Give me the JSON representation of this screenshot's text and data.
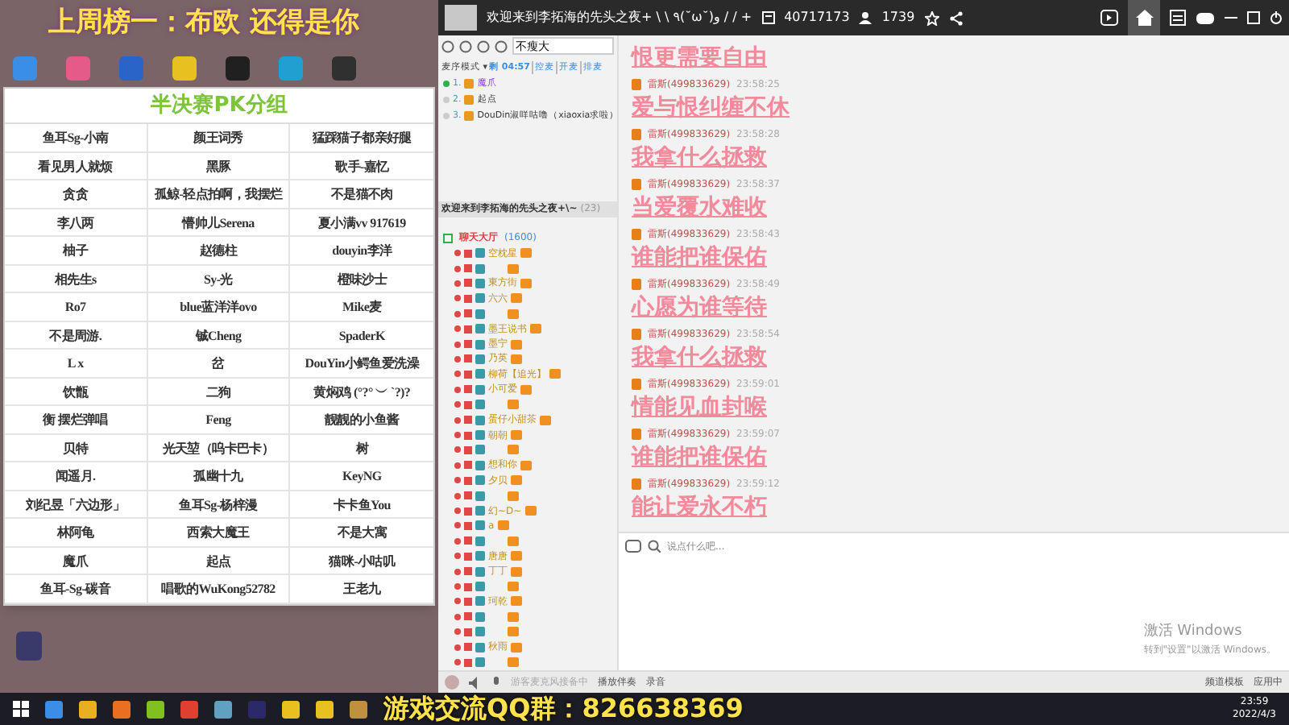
{
  "overlay_top": "上周榜一：布欧 还得是你",
  "pk_table": {
    "title": "半决赛PK分组",
    "rows": [
      [
        "鱼耳Sg-小南",
        "颜王词秀",
        "猛踩猫子都亲好腿"
      ],
      [
        "看见男人就烦",
        "黑豚",
        "歌手-嘉忆"
      ],
      [
        "贪贪",
        "孤鲸-轻点拍啊，我摆烂",
        "不是猫不肉"
      ],
      [
        "李八两",
        "懵帅儿Serena",
        "夏小满vv 917619"
      ],
      [
        "柚子",
        "赵德柱",
        "douyin李洋"
      ],
      [
        "相先生s",
        "Sy-光",
        "橙味沙士"
      ],
      [
        "Ro7",
        "blue蓝洋洋ovo",
        "Mike麦"
      ],
      [
        "不是周游.",
        "铖Cheng",
        "SpaderK"
      ],
      [
        "L x",
        "岔",
        "DouYin小鳄鱼爱洗澡"
      ],
      [
        "饮甑",
        "二狗",
        "黄焖鸡 (°?° ︶ `?)?"
      ],
      [
        "衡 摆烂弹唱",
        "Feng",
        "靓靓的小鱼酱"
      ],
      [
        "贝特",
        "光天堃（呜卡巴卡）",
        "树"
      ],
      [
        "闻遥月.",
        "孤幽十九",
        "KeyNG"
      ],
      [
        "刘纪昱「六边形」",
        "鱼耳Sg-杨梓漫",
        "卡卡鱼You"
      ],
      [
        "林阿龟",
        "西索大魔王",
        "不是大寓"
      ],
      [
        "魔爪",
        "起点",
        "猫咪-小咕叽"
      ],
      [
        "鱼耳-Sg-碳音",
        "唱歌的WuKong52782",
        "王老九"
      ]
    ]
  },
  "window": {
    "title": "欢迎来到李拓海的先头之夜+ \\ \\ ٩(˘ω˘)و / / +",
    "room_id": "40717173",
    "online": "1739"
  },
  "left_panel": {
    "search": {
      "value": "不瘦大"
    },
    "mode": "麦序模式 ▾",
    "timer": "剩 04:57",
    "actions": [
      "控麦",
      "开麦",
      "排麦"
    ],
    "queue": [
      {
        "rank": "1.",
        "name": "魔爪",
        "active": true
      },
      {
        "rank": "2.",
        "name": "起点",
        "active": false
      },
      {
        "rank": "3.",
        "name": "DouDin淑咩咕噜（xiaoxia求啦）",
        "active": false
      }
    ],
    "channel": {
      "name": "欢迎来到李拓海的先头之夜+\\~",
      "count": "(23)",
      "sub": "聊天大厅",
      "sub_count": "(1600)"
    },
    "users": [
      {
        "kind": "named",
        "name": "空枕星"
      },
      {
        "kind": "anonymous"
      },
      {
        "kind": "named",
        "name": "東方街"
      },
      {
        "kind": "named",
        "name": "六六"
      },
      {
        "kind": "anonymous"
      },
      {
        "kind": "named",
        "name": "墨王说书"
      },
      {
        "kind": "named",
        "name": "墨宁"
      },
      {
        "kind": "named",
        "name": "乃英"
      },
      {
        "kind": "named",
        "name": "柳荷【追光】"
      },
      {
        "kind": "named",
        "name": "小可爱"
      },
      {
        "kind": "anonymous"
      },
      {
        "kind": "named",
        "name": "蛋仔小甜茶"
      },
      {
        "kind": "named",
        "name": "朝朝"
      },
      {
        "kind": "anonymous"
      },
      {
        "kind": "named",
        "name": "想和你"
      },
      {
        "kind": "named",
        "name": "夕贝"
      },
      {
        "kind": "anonymous"
      },
      {
        "kind": "named",
        "name": "幻~D~"
      },
      {
        "kind": "named",
        "name": "a"
      },
      {
        "kind": "anonymous"
      },
      {
        "kind": "named",
        "name": "唐唐"
      },
      {
        "kind": "named",
        "name": "丁丁"
      },
      {
        "kind": "anonymous"
      },
      {
        "kind": "named",
        "name": "珂乾"
      },
      {
        "kind": "anonymous"
      },
      {
        "kind": "anonymous"
      },
      {
        "kind": "named",
        "name": "秋雨"
      },
      {
        "kind": "anonymous"
      }
    ]
  },
  "chat": {
    "first_message": "恨更需要自由",
    "messages": [
      {
        "sender": "雷斯(499833629)",
        "time": "23:58:25",
        "text": "爱与恨纠缠不休"
      },
      {
        "sender": "雷斯(499833629)",
        "time": "23:58:28",
        "text": "我拿什么拯救"
      },
      {
        "sender": "雷斯(499833629)",
        "time": "23:58:37",
        "text": "当爱覆水难收"
      },
      {
        "sender": "雷斯(499833629)",
        "time": "23:58:43",
        "text": "谁能把谁保佑"
      },
      {
        "sender": "雷斯(499833629)",
        "time": "23:58:49",
        "text": "心愿为谁等待"
      },
      {
        "sender": "雷斯(499833629)",
        "time": "23:58:54",
        "text": "我拿什么拯救"
      },
      {
        "sender": "雷斯(499833629)",
        "time": "23:59:01",
        "text": "情能见血封喉"
      },
      {
        "sender": "雷斯(499833629)",
        "time": "23:59:07",
        "text": "谁能把谁保佑"
      },
      {
        "sender": "雷斯(499833629)",
        "time": "23:59:12",
        "text": "能让爱永不朽"
      }
    ],
    "input": {
      "placeholder": "说点什么吧..."
    }
  },
  "toolbar": {
    "mic_status": "游客麦克风接备中",
    "accompaniment": "播放伴奏",
    "record": "录音",
    "template": "频道模板",
    "app": "应用中"
  },
  "activation": {
    "title": "激活 Windows",
    "hint": "转到\"设置\"以激活 Windows。"
  },
  "overlay_bottom": "游戏交流QQ群：826638369",
  "taskbar": {
    "time": "23:59",
    "date": "2022/4/3"
  }
}
